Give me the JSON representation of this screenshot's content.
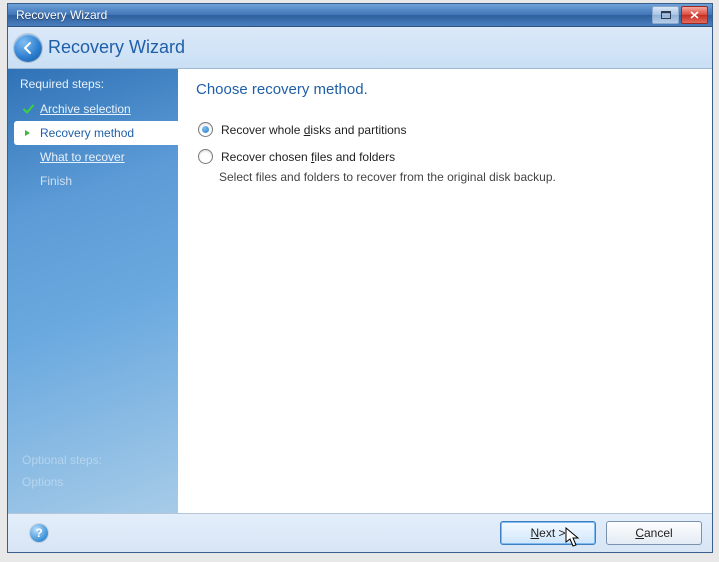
{
  "window": {
    "title": "Recovery Wizard"
  },
  "header": {
    "title": "Recovery Wizard"
  },
  "sidebar": {
    "heading": "Required steps:",
    "steps": [
      {
        "label": "Archive selection"
      },
      {
        "label": "Recovery method"
      },
      {
        "label": "What to recover"
      },
      {
        "label": "Finish"
      }
    ],
    "optional_heading": "Optional steps:",
    "optional_item": "Options"
  },
  "content": {
    "title": "Choose recovery method.",
    "option1": {
      "pre": "Recover whole ",
      "ak": "d",
      "post": "isks and partitions"
    },
    "option2": {
      "pre": "Recover chosen ",
      "ak": "f",
      "post": "iles and folders"
    },
    "option2_desc": "Select files and folders to recover from the original disk backup."
  },
  "footer": {
    "next": {
      "ak": "N",
      "rest": "ext >"
    },
    "cancel": {
      "ak": "C",
      "rest": "ancel"
    }
  }
}
